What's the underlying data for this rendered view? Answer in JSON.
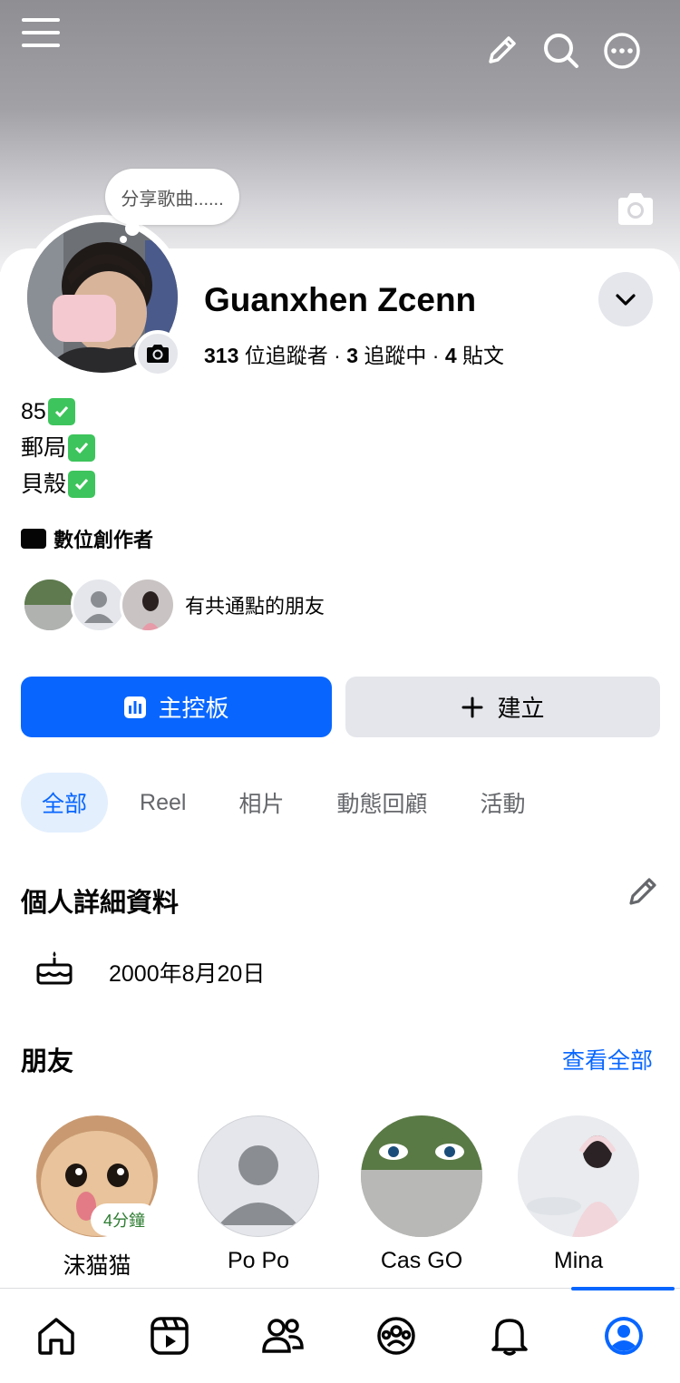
{
  "header": {
    "icons": [
      "menu-icon",
      "pencil-icon",
      "search-icon",
      "more-icon"
    ]
  },
  "profile": {
    "note_bubble": "分享歌曲......",
    "name": "Guanxhen Zcenn",
    "followers_count": "313",
    "followers_label": "位追蹤者",
    "following_count": "3",
    "following_label": "追蹤中",
    "posts_count": "4",
    "posts_label": "貼文",
    "separator": "·"
  },
  "bio": {
    "lines": [
      "85",
      "郵局",
      "貝殼"
    ]
  },
  "category": "數位創作者",
  "mutual_friends_text": "有共通點的朋友",
  "actions": {
    "dashboard_label": "主控板",
    "create_label": "建立"
  },
  "tabs": [
    {
      "label": "全部",
      "active": true
    },
    {
      "label": "Reel",
      "active": false
    },
    {
      "label": "相片",
      "active": false
    },
    {
      "label": "動態回顧",
      "active": false
    },
    {
      "label": "活動",
      "active": false
    }
  ],
  "details": {
    "title": "個人詳細資料",
    "birthday": "2000年8月20日"
  },
  "friends": {
    "title": "朋友",
    "see_all": "查看全部",
    "items": [
      {
        "name": "沫猫猫",
        "badge": "4分鐘"
      },
      {
        "name": "Po Po"
      },
      {
        "name": "Cas GO"
      },
      {
        "name": "Mina"
      }
    ]
  },
  "bottom_nav": [
    "home-icon",
    "reels-icon",
    "friends-icon",
    "groups-icon",
    "notifications-icon",
    "profile-icon"
  ],
  "colors": {
    "accent": "#0866ff",
    "secondary_button": "#e4e6eb",
    "online_badge_text": "#2e7d32",
    "check_green": "#3ec45c"
  }
}
